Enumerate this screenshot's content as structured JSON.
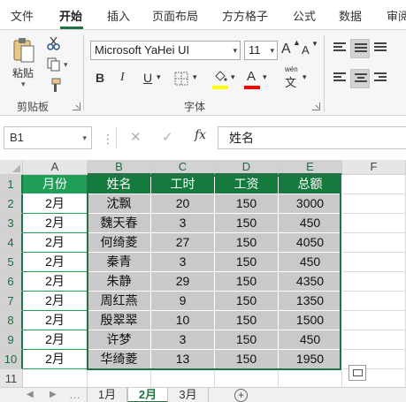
{
  "ribbon_tabs": [
    "文件",
    "开始",
    "插入",
    "页面布局",
    "方方格子",
    "公式",
    "数据",
    "审阅"
  ],
  "active_tab": "开始",
  "clipboard": {
    "paste_label": "粘贴",
    "group_label": "剪贴板"
  },
  "font": {
    "name": "Microsoft YaHei UI",
    "size": "11",
    "group_label": "字体",
    "bold": "B",
    "italic": "I",
    "underline": "U",
    "grow": "A",
    "shrink": "A",
    "phonetic": "wén"
  },
  "colors": {
    "accent": "#217346",
    "header_fill": "#1f9e57",
    "selected_header_fill": "#157a3e",
    "selected_cell_fill": "#c9c9c9",
    "highlight": "#ffff00",
    "font_color": "#ff0000"
  },
  "formula_bar": {
    "name_box": "B1",
    "formula": "姓名",
    "fx": "fx",
    "cancel": "✕",
    "enter": "✓"
  },
  "columns": [
    "A",
    "B",
    "C",
    "D",
    "E",
    "F"
  ],
  "row_numbers": [
    "1",
    "2",
    "3",
    "4",
    "5",
    "6",
    "7",
    "8",
    "9",
    "10",
    "11"
  ],
  "table": {
    "headers": [
      "月份",
      "姓名",
      "工时",
      "工资",
      "总额"
    ],
    "rows": [
      [
        "2月",
        "沈飘",
        "20",
        "150",
        "3000"
      ],
      [
        "2月",
        "魏天春",
        "3",
        "150",
        "450"
      ],
      [
        "2月",
        "何绮菱",
        "27",
        "150",
        "4050"
      ],
      [
        "2月",
        "秦青",
        "3",
        "150",
        "450"
      ],
      [
        "2月",
        "朱静",
        "29",
        "150",
        "4350"
      ],
      [
        "2月",
        "周红燕",
        "9",
        "150",
        "1350"
      ],
      [
        "2月",
        "殷翠翠",
        "10",
        "150",
        "1500"
      ],
      [
        "2月",
        "许梦",
        "3",
        "150",
        "450"
      ],
      [
        "2月",
        "华绮菱",
        "13",
        "150",
        "1950"
      ]
    ]
  },
  "sheets": [
    "1月",
    "2月",
    "3月"
  ],
  "active_sheet": "2月",
  "add_sheet": "+"
}
